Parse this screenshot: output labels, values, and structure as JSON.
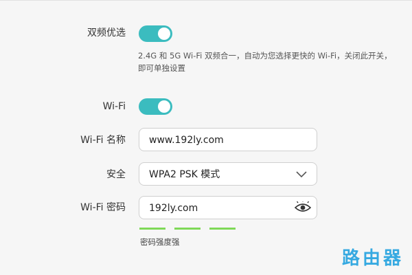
{
  "dual_band": {
    "label": "双频优选",
    "enabled": true,
    "description": "2.4G 和 5G Wi-Fi 双频合一，自动为您选择更快的 Wi-Fi，关闭此开关，即可单独设置"
  },
  "wifi": {
    "label": "Wi-Fi",
    "enabled": true
  },
  "wifi_name": {
    "label": "Wi-Fi 名称",
    "value": "www.192ly.com"
  },
  "security": {
    "label": "安全",
    "selected": "WPA2 PSK 模式"
  },
  "wifi_password": {
    "label": "Wi-Fi 密码",
    "value": "192ly.com"
  },
  "password_strength": {
    "text": "密码强度强",
    "level": 3,
    "max_level": 3,
    "color": "#7ed957"
  },
  "colors": {
    "toggle_on": "#3bbcbf",
    "watermark": "#36a9e1"
  },
  "watermark_text": "路由器"
}
